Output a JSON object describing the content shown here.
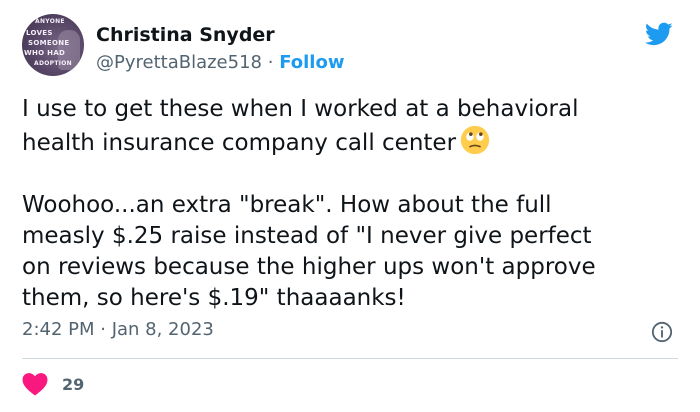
{
  "author": {
    "name": "Christina Snyder",
    "handle": "@PyrettaBlaze518",
    "separator": "·",
    "follow_label": "Follow",
    "avatar_text": [
      "ANYONE",
      "LOVES",
      "SOMEONE",
      "WHO HAD",
      "ADOPTION"
    ]
  },
  "tweet": {
    "paragraph1": "I use to get these when I worked at a behavioral\nhealth insurance company call center",
    "paragraph1_emoji": "face-with-rolling-eyes",
    "paragraph2": "Woohoo...an extra \"break\". How about the full\nmeasly $.25 raise instead of \"I never give perfect\non reviews because the higher ups won't approve\nthem, so here's $.19\" thaaaanks!",
    "timestamp": "2:42 PM · Jan 8, 2023"
  },
  "engagement": {
    "likes": "29"
  },
  "colors": {
    "brand_blue": "#1d9bf0",
    "heart_pink": "#f91880",
    "secondary_text": "#536471"
  },
  "icons": {
    "platform": "twitter-bird-icon",
    "info": "info-icon",
    "like": "heart-icon"
  }
}
